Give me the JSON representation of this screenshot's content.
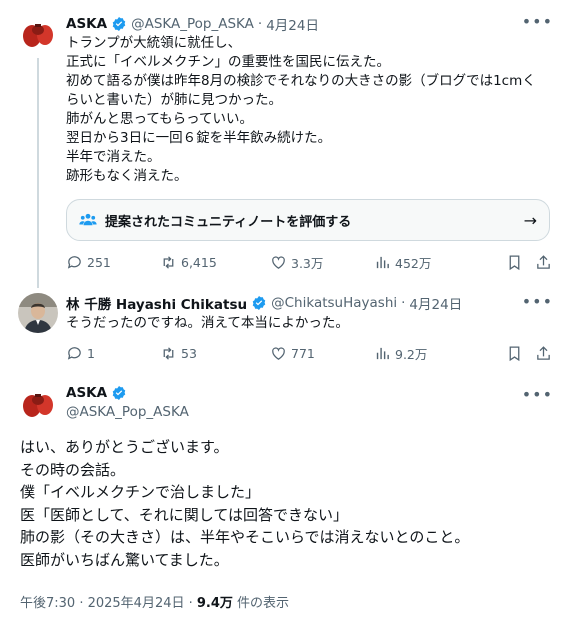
{
  "post1": {
    "name": "ASKA",
    "handle": "@ASKA_Pop_ASKA",
    "dot": "·",
    "date": "4月24日",
    "lines": [
      "トランプが大統領に就任し、",
      "正式に「イベルメクチン」の重要性を国民に伝えた。",
      "初めて語るが僕は昨年8月の検診でそれなりの大きさの影（ブログでは1cmく",
      "らいと書いた）が肺に見つかった。",
      "肺がんと思ってもらっていい。",
      "翌日から3日に一回６錠を半年飲み続けた。",
      "半年で消えた。",
      "跡形もなく消えた。"
    ],
    "note_label": "提案されたコミュニティノートを評価する",
    "replies": "251",
    "reposts": "6,415",
    "likes": "3.3万",
    "views": "452万"
  },
  "post2": {
    "name": "林 千勝 Hayashi Chikatsu",
    "handle": "@ChikatsuHayashi",
    "dot": "·",
    "date": "4月24日",
    "text": "そうだったのですね。消えて本当によかった。",
    "replies": "1",
    "reposts": "53",
    "likes": "771",
    "views": "9.2万"
  },
  "post3": {
    "name": "ASKA",
    "handle": "@ASKA_Pop_ASKA",
    "lines": [
      "はい、ありがとうございます。",
      "その時の会話。",
      "僕「イベルメクチンで治しました」",
      "医「医師として、それに関しては回答できない」",
      "肺の影（その大きさ）は、半年やそこいらでは消えないとのこと。",
      "医師がいちばん驚いてました。"
    ],
    "timestamp": "午後7:30 · 2025年4月24日 · ",
    "view_count": "9.4万",
    "view_suffix": " 件の表示"
  },
  "colors": {
    "verified": "#1d9bf0",
    "secondary": "#536471",
    "border": "#cfd9de"
  }
}
